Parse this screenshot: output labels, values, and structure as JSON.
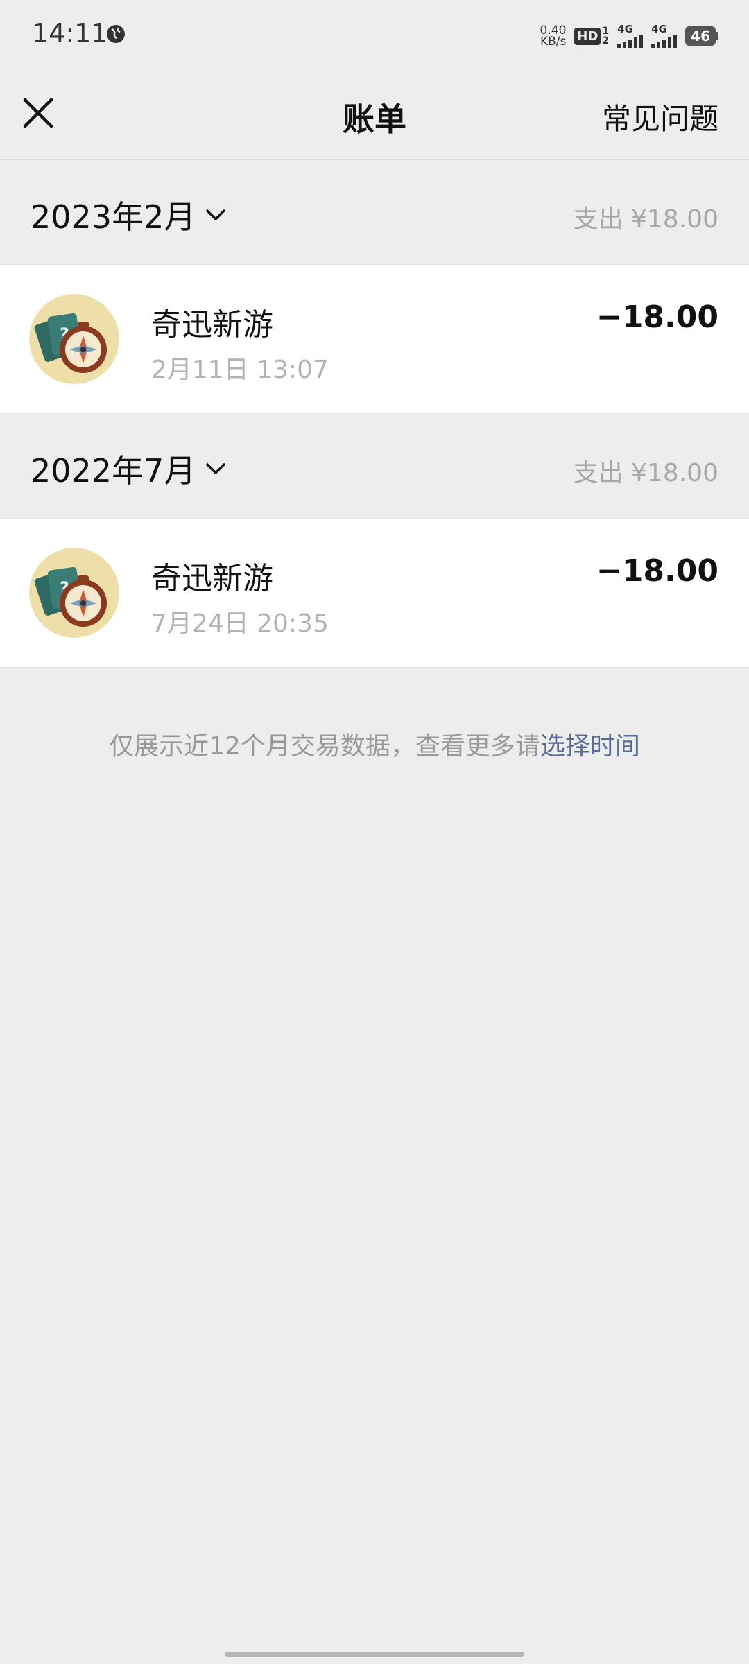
{
  "status_bar": {
    "time": "14:11",
    "net_speed_value": "0.40",
    "net_speed_unit": "KB/s",
    "hd_label": "HD",
    "hd_sim1": "1",
    "hd_sim2": "2",
    "signal1_label": "4G",
    "signal2_label": "4G",
    "battery_level": "46"
  },
  "nav": {
    "title": "账单",
    "faq_label": "常见问题"
  },
  "months": [
    {
      "label": "2023年2月",
      "summary": "支出 ¥18.00",
      "transactions": [
        {
          "name": "奇迅新游",
          "time": "2月11日 13:07",
          "amount": "−18.00",
          "icon": "compass-game-icon"
        }
      ]
    },
    {
      "label": "2022年7月",
      "summary": "支出 ¥18.00",
      "transactions": [
        {
          "name": "奇迅新游",
          "time": "7月24日 20:35",
          "amount": "−18.00",
          "icon": "compass-game-icon"
        }
      ]
    }
  ],
  "footer": {
    "note": "仅展示近12个月交易数据，查看更多请",
    "link": "选择时间"
  },
  "colors": {
    "background": "#ededed",
    "link": "#576b95",
    "muted_text": "#a8a8a8"
  }
}
